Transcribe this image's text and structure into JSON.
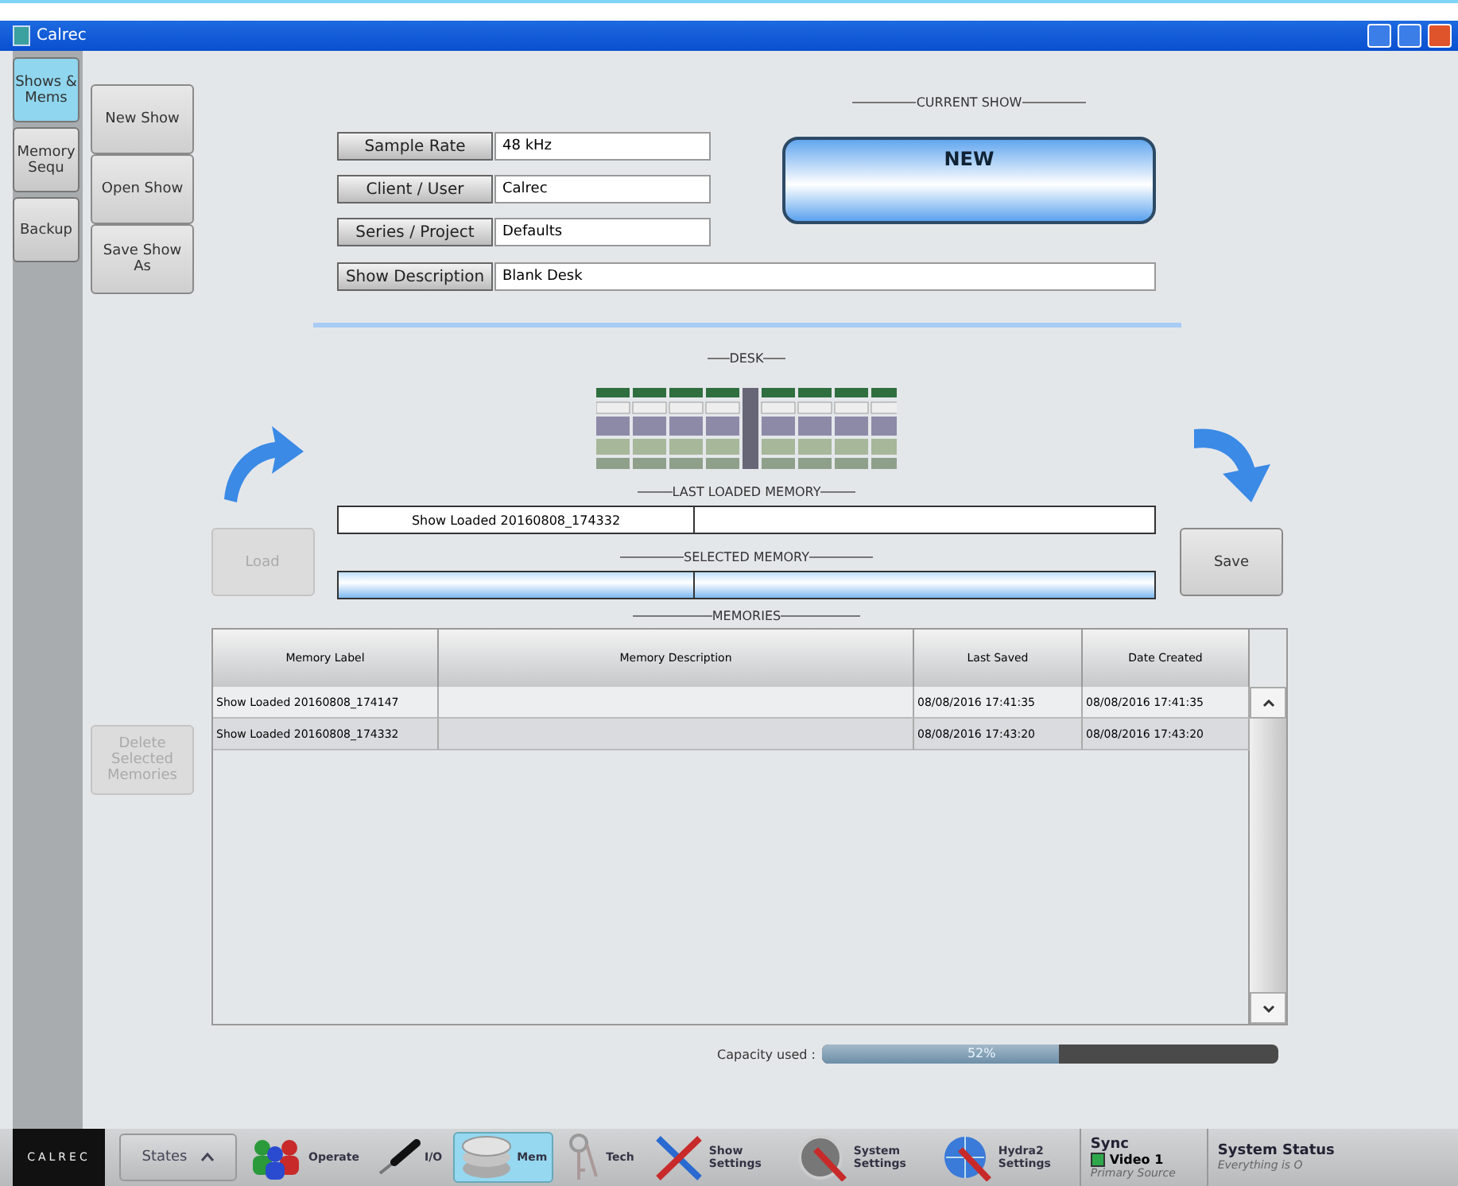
{
  "window": {
    "title": "Calrec"
  },
  "side_tabs": [
    {
      "label": "Shows & Mems",
      "selected": true
    },
    {
      "label": "Memory Sequ",
      "selected": false
    },
    {
      "label": "Backup",
      "selected": false
    }
  ],
  "show_buttons": [
    "New Show",
    "Open Show",
    "Save Show As"
  ],
  "fields": [
    {
      "label": "Sample Rate",
      "value": "48 kHz"
    },
    {
      "label": "Client / User",
      "value": "Calrec"
    },
    {
      "label": "Series / Project",
      "value": "Defaults"
    }
  ],
  "description": {
    "label": "Show Description",
    "value": "Blank Desk"
  },
  "current_show": {
    "heading": "CURRENT SHOW",
    "name": "NEW"
  },
  "desk_heading": "DESK",
  "last_loaded": {
    "heading": "LAST LOADED MEMORY",
    "value": "Show Loaded 20160808_174332"
  },
  "selected_memory": {
    "heading": "SELECTED MEMORY"
  },
  "load_button": {
    "label": "Load",
    "disabled": true
  },
  "save_button": {
    "label": "Save",
    "disabled": false
  },
  "delete_button": {
    "label": "Delete Selected Memories",
    "disabled": true
  },
  "memories": {
    "heading": "MEMORIES",
    "columns": [
      "Memory Label",
      "Memory Description",
      "Last Saved",
      "Date Created"
    ],
    "rows": [
      {
        "cells": [
          "Show Loaded 20160808_174147",
          "",
          "08/08/2016 17:41:35",
          "08/08/2016 17:41:35"
        ],
        "selected": false
      },
      {
        "cells": [
          "Show Loaded 20160808_174332",
          "",
          "08/08/2016 17:43:20",
          "08/08/2016 17:43:20"
        ],
        "selected": false
      }
    ]
  },
  "capacity": {
    "label": "Capacity used :",
    "reading": "52%",
    "level": 0.52
  },
  "taskbar": {
    "logo": "CALREC",
    "states": "States",
    "items": [
      {
        "kind": "operate",
        "label": "Operate",
        "selected": false
      },
      {
        "kind": "io",
        "label": "I/O",
        "selected": false
      },
      {
        "kind": "mem",
        "label": "Mem",
        "selected": true
      },
      {
        "kind": "tech",
        "label": "Tech",
        "selected": false
      },
      {
        "kind": "show",
        "label": "Show Settings",
        "selected": false
      },
      {
        "kind": "system",
        "label": "System Settings",
        "selected": false
      },
      {
        "kind": "hydra",
        "label": "Hydra2 Settings",
        "selected": false
      }
    ],
    "sync": {
      "title": "Sync",
      "source": "Video 1",
      "color": "#2ea84a",
      "note": "Primary Source"
    },
    "status": {
      "title": "System Status",
      "note": "Everything is O"
    }
  }
}
